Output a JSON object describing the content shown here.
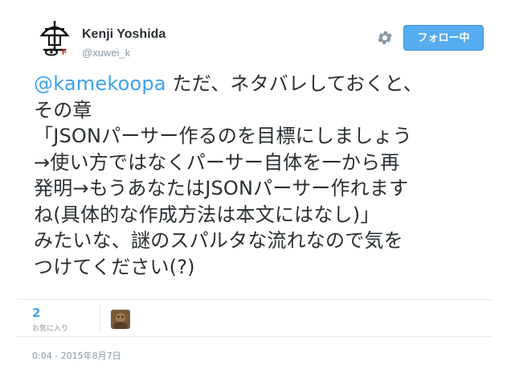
{
  "author": {
    "name": "Kenji Yoshida",
    "handle": "@xuwei_k"
  },
  "follow_button": {
    "label": "フォロー中"
  },
  "tweet": {
    "mention": "@kamekoopa",
    "line1_rest": " ただ、ネタバレしておくと、",
    "lines": [
      "その章",
      "「JSONパーサー作るのを目標にしましょう",
      "→使い方ではなくパーサー自体を一から再",
      "発明→もうあなたはJSONパーサー作れます",
      "ね(具体的な作成方法は本文にはなし)」",
      "みたいな、謎のスパルタな流れなので気を",
      "つけてください(?)"
    ]
  },
  "stats": {
    "favorites_count": "2",
    "favorites_label": "お気に入り"
  },
  "timestamp": "0:04 - 2015年8月7日",
  "colors": {
    "accent": "#55acee",
    "link": "#3ea1ec",
    "muted": "#8899a6",
    "text": "#292f33"
  },
  "icons": {
    "avatar": "avatar-icon",
    "settings": "gear-icon"
  }
}
